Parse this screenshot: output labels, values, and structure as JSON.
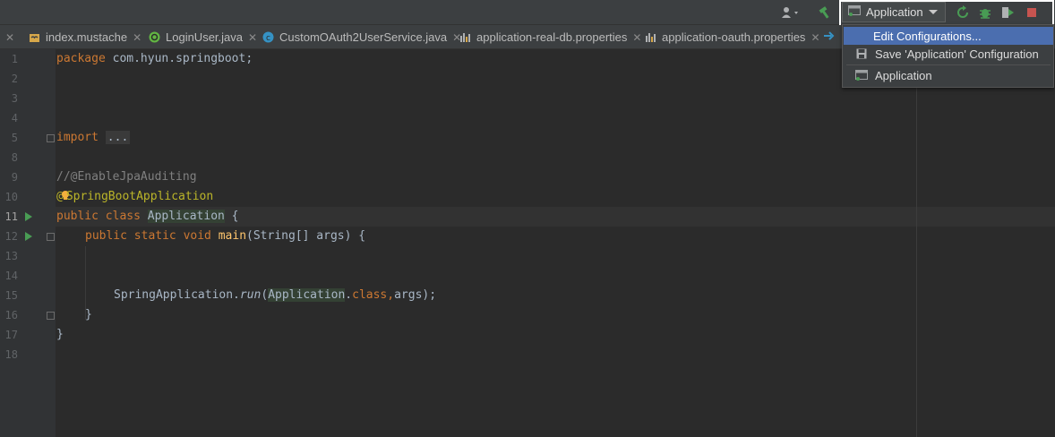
{
  "toolbar": {
    "run_config_label": "Application",
    "icons": [
      "user-icon",
      "build-hammer-icon",
      "rerun-icon",
      "debug-icon",
      "coverage-icon",
      "stop-icon"
    ]
  },
  "tabs": [
    {
      "label": "index.mustache",
      "icon": "mustache-file-icon"
    },
    {
      "label": "LoginUser.java",
      "icon": "java-interface-icon"
    },
    {
      "label": "CustomOAuth2UserService.java",
      "icon": "java-class-icon"
    },
    {
      "label": "application-real-db.properties",
      "icon": "properties-file-icon"
    },
    {
      "label": "application-oauth.properties",
      "icon": "properties-file-icon"
    }
  ],
  "dropdown": {
    "items": [
      {
        "label": "Edit Configurations...",
        "selected": true
      },
      {
        "label": "Save 'Application' Configuration",
        "icon": "save-icon"
      },
      {
        "label": "Application",
        "icon": "application-config-icon"
      }
    ]
  },
  "editor": {
    "line_numbers": [
      "1",
      "2",
      "3",
      "4",
      "5",
      "8",
      "9",
      "10",
      "11",
      "12",
      "13",
      "14",
      "15",
      "16",
      "17",
      "18"
    ],
    "code": {
      "l1_kw": "package",
      "l1_rest": " com.hyun.springboot;",
      "l5_kw": "import",
      "l5_fold": "...",
      "l9": "//@EnableJpaAuditing",
      "l10_at": "@",
      "l10_rest": "SpringBootApplication",
      "l11_kw": "public class",
      "l11_cls": "Application",
      "l11_rest": " {",
      "l12_kw": "public static void",
      "l12_fn": "main",
      "l12_rest": "(String[] args) {",
      "l15_a": "SpringApplication.",
      "l15_run": "run",
      "l15_paren": "(",
      "l15_cls": "Application",
      "l15_dot": ".",
      "l15_kw": "class",
      "l15_comma": ",",
      "l15_rest": "args);",
      "l16": "}",
      "l17": "}"
    }
  },
  "colors": {
    "keyword": "#cc7832",
    "annotation": "#bbb529",
    "comment": "#808080",
    "method": "#ffc66d",
    "selection": "#4b6eaf",
    "run_green": "#499c54"
  }
}
